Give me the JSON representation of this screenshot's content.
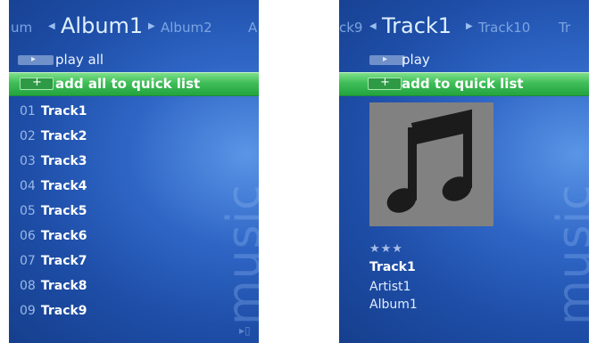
{
  "left": {
    "pivot": {
      "prev": "um",
      "current": "Album1",
      "next": "Album2",
      "next2": "A"
    },
    "play_label": "play all",
    "quicklist_label": "add all to quick list",
    "tracks": [
      {
        "num": "01",
        "title": "Track1"
      },
      {
        "num": "02",
        "title": "Track2"
      },
      {
        "num": "03",
        "title": "Track3"
      },
      {
        "num": "04",
        "title": "Track4"
      },
      {
        "num": "05",
        "title": "Track5"
      },
      {
        "num": "06",
        "title": "Track6"
      },
      {
        "num": "07",
        "title": "Track7"
      },
      {
        "num": "08",
        "title": "Track8"
      },
      {
        "num": "09",
        "title": "Track9"
      }
    ],
    "watermark": "music"
  },
  "right": {
    "pivot": {
      "prev": "ck9",
      "current": "Track1",
      "next": "Track10",
      "next2": "Tr"
    },
    "play_label": "play",
    "quicklist_label": "add to quick list",
    "rating": "★★★",
    "track": "Track1",
    "artist": "Artist1",
    "album": "Album1",
    "watermark": "music"
  },
  "icons": {
    "play": "play-icon",
    "add": "plus-icon",
    "note": "music-note-icon",
    "arrow_left": "left-arrow-icon",
    "arrow_right": "right-arrow-icon"
  },
  "colors": {
    "panel_blue": "#2f66c6",
    "highlight_green": "#3fbd58",
    "album_art_gray": "#818181"
  }
}
